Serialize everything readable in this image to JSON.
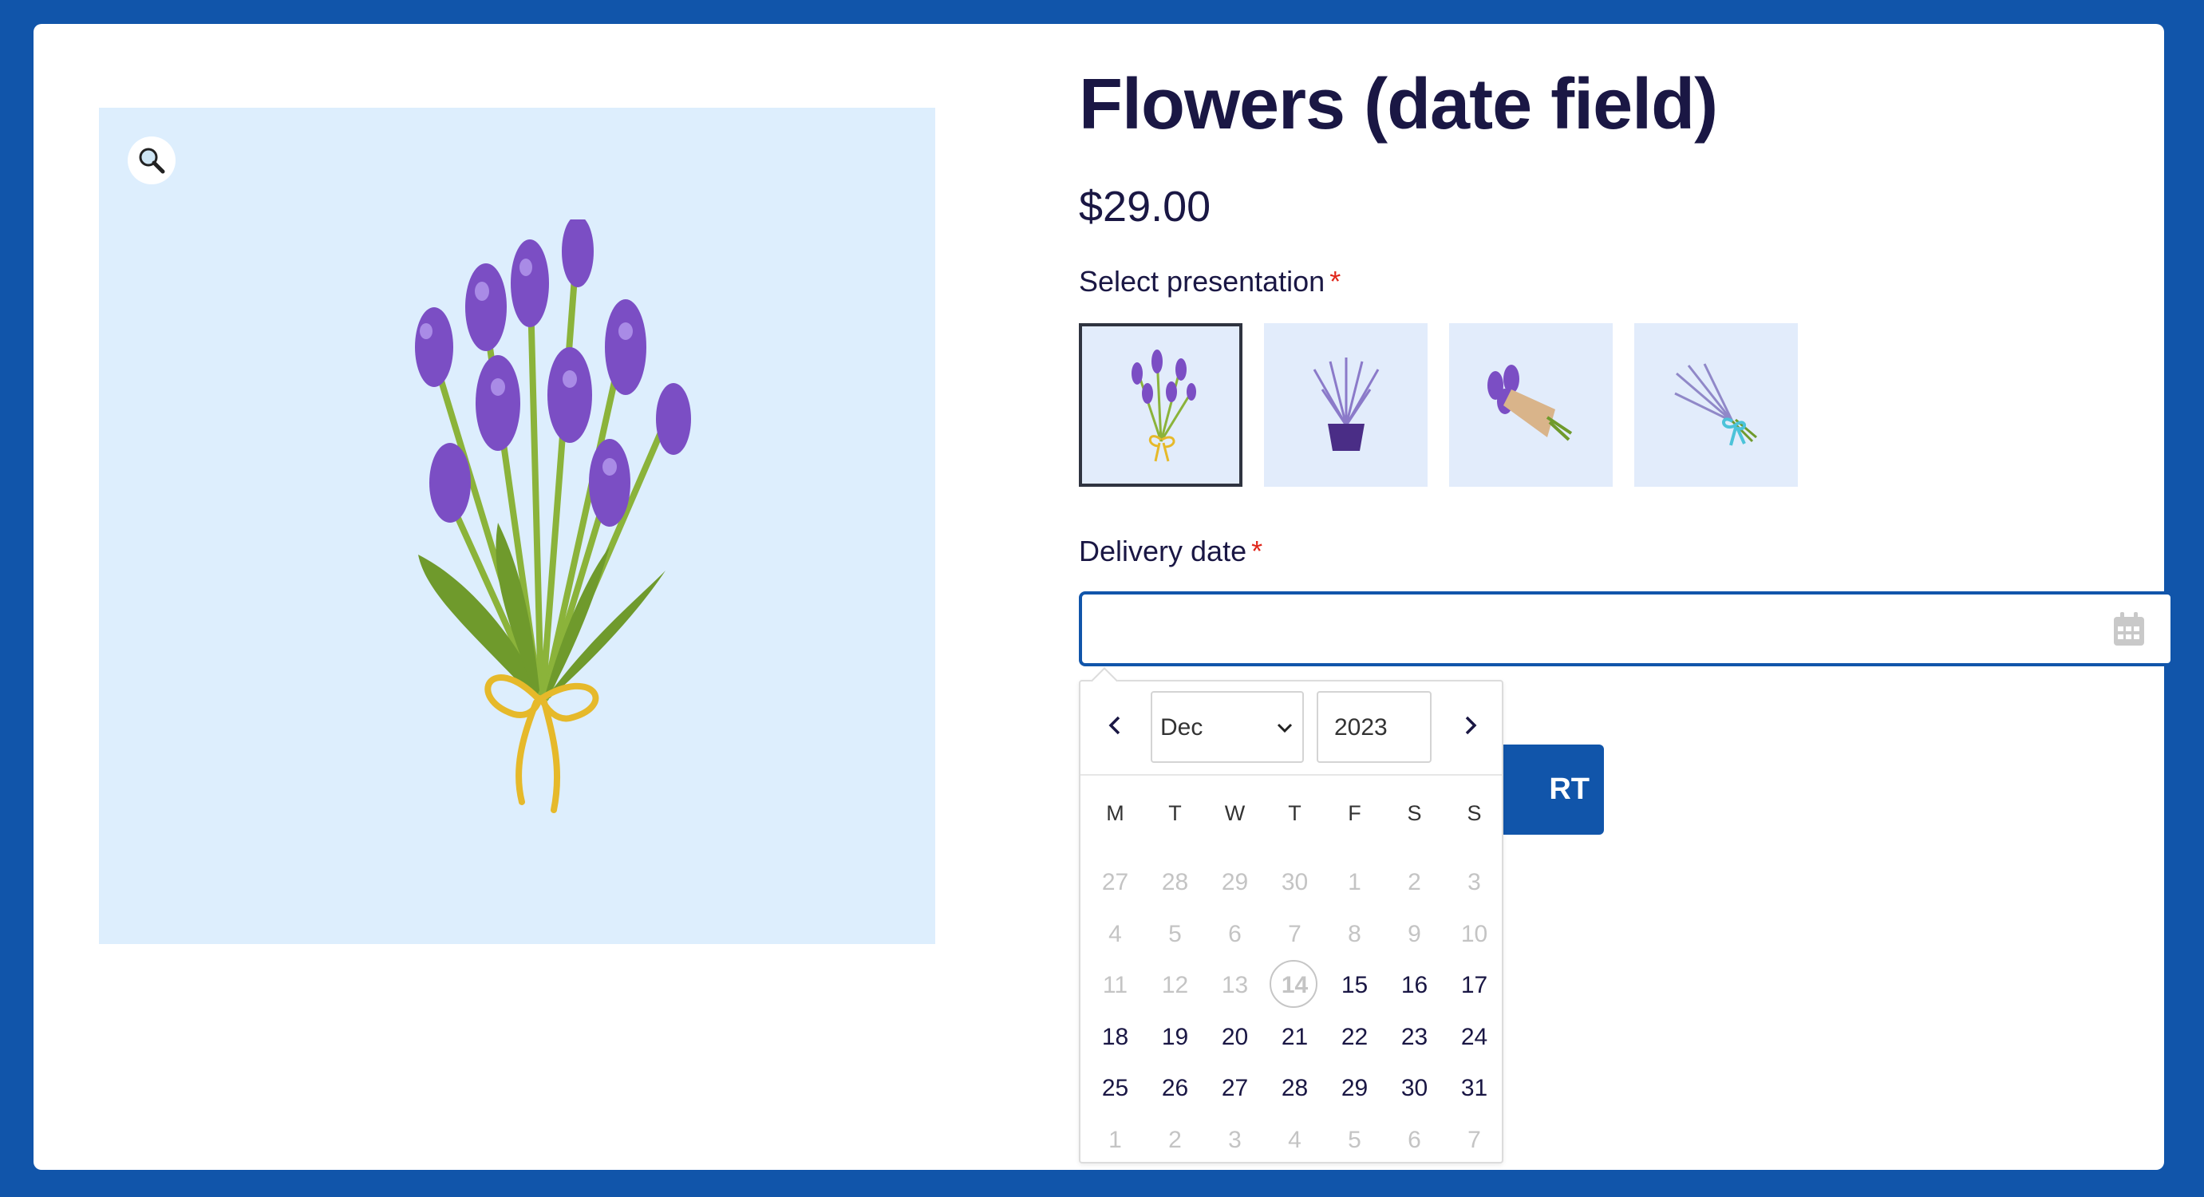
{
  "product": {
    "title": "Flowers (date field)",
    "price": "$29.00"
  },
  "presentation": {
    "label": "Select presentation",
    "required_mark": "*",
    "options": [
      {
        "name": "Bouquet",
        "selected": true
      },
      {
        "name": "Pot",
        "selected": false
      },
      {
        "name": "Wrapped bouquet",
        "selected": false
      },
      {
        "name": "Ribbon bunch",
        "selected": false
      }
    ]
  },
  "delivery": {
    "label": "Delivery date",
    "required_mark": "*",
    "value": ""
  },
  "cart": {
    "visible_label": "RT"
  },
  "datepicker": {
    "month": "Dec",
    "year": "2023",
    "weekdays": [
      "M",
      "T",
      "W",
      "T",
      "F",
      "S",
      "S"
    ],
    "weeks": [
      [
        {
          "d": "27",
          "s": "other"
        },
        {
          "d": "28",
          "s": "other"
        },
        {
          "d": "29",
          "s": "other"
        },
        {
          "d": "30",
          "s": "other"
        },
        {
          "d": "1",
          "s": "disabled"
        },
        {
          "d": "2",
          "s": "disabled"
        },
        {
          "d": "3",
          "s": "disabled"
        }
      ],
      [
        {
          "d": "4",
          "s": "disabled"
        },
        {
          "d": "5",
          "s": "disabled"
        },
        {
          "d": "6",
          "s": "disabled"
        },
        {
          "d": "7",
          "s": "disabled"
        },
        {
          "d": "8",
          "s": "disabled"
        },
        {
          "d": "9",
          "s": "disabled"
        },
        {
          "d": "10",
          "s": "disabled"
        }
      ],
      [
        {
          "d": "11",
          "s": "disabled"
        },
        {
          "d": "12",
          "s": "disabled"
        },
        {
          "d": "13",
          "s": "disabled"
        },
        {
          "d": "14",
          "s": "today"
        },
        {
          "d": "15",
          "s": "avail"
        },
        {
          "d": "16",
          "s": "avail"
        },
        {
          "d": "17",
          "s": "avail"
        }
      ],
      [
        {
          "d": "18",
          "s": "avail"
        },
        {
          "d": "19",
          "s": "avail"
        },
        {
          "d": "20",
          "s": "avail"
        },
        {
          "d": "21",
          "s": "avail"
        },
        {
          "d": "22",
          "s": "avail"
        },
        {
          "d": "23",
          "s": "avail"
        },
        {
          "d": "24",
          "s": "avail"
        }
      ],
      [
        {
          "d": "25",
          "s": "avail"
        },
        {
          "d": "26",
          "s": "avail"
        },
        {
          "d": "27",
          "s": "avail"
        },
        {
          "d": "28",
          "s": "avail"
        },
        {
          "d": "29",
          "s": "avail"
        },
        {
          "d": "30",
          "s": "avail"
        },
        {
          "d": "31",
          "s": "avail"
        }
      ],
      [
        {
          "d": "1",
          "s": "other"
        },
        {
          "d": "2",
          "s": "other"
        },
        {
          "d": "3",
          "s": "other"
        },
        {
          "d": "4",
          "s": "other"
        },
        {
          "d": "5",
          "s": "other"
        },
        {
          "d": "6",
          "s": "other"
        },
        {
          "d": "7",
          "s": "other"
        }
      ]
    ]
  },
  "colors": {
    "frame": "#1155aa",
    "heading": "#1a1744",
    "required": "#e0261b",
    "image_bg": "#ddeefd"
  },
  "icons": {
    "zoom": "magnifier-icon",
    "calendar": "calendar-icon",
    "prev": "chevron-left-icon",
    "next": "chevron-right-icon"
  }
}
